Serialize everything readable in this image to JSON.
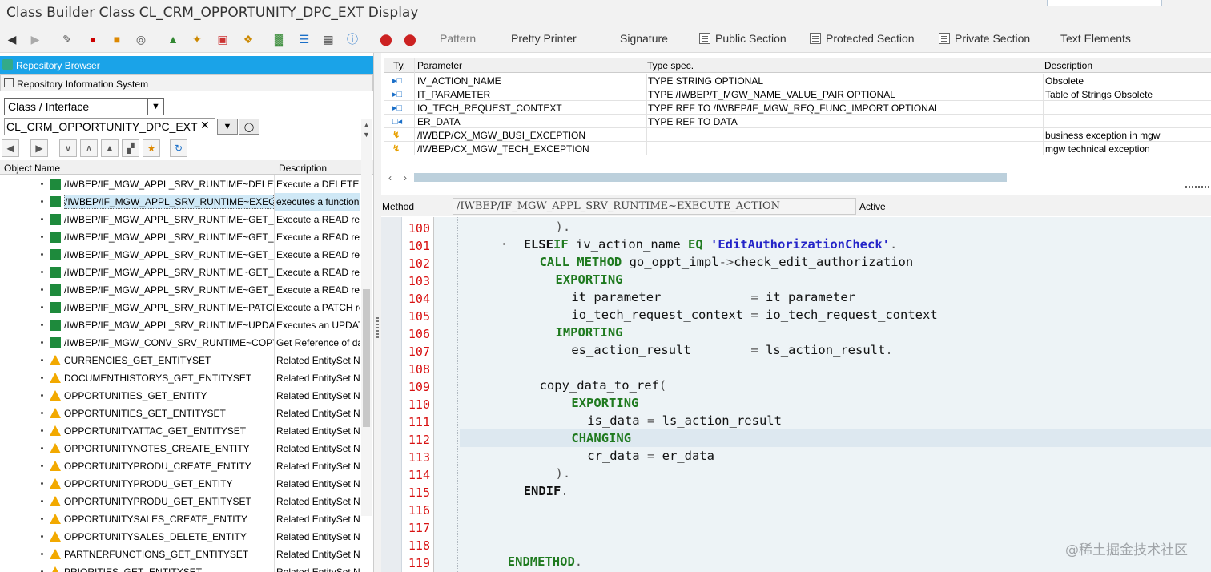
{
  "window": {
    "title": "Class Builder Class CL_CRM_OPPORTUNITY_DPC_EXT Display"
  },
  "toolbar": {
    "pattern": "Pattern",
    "pretty_printer": "Pretty Printer",
    "signature": "Signature",
    "public_section": "Public Section",
    "protected_section": "Protected Section",
    "private_section": "Private Section",
    "text_elements": "Text Elements"
  },
  "left": {
    "repository_browser": "Repository Browser",
    "repository_info": "Repository Information System",
    "object_type": "Class / Interface",
    "object_name": "CL_CRM_OPPORTUNITY_DPC_EXT",
    "col_object": "Object Name",
    "col_desc": "Description",
    "rows": [
      {
        "name": "/IWBEP/IF_MGW_APPL_SRV_RUNTIME~DELETE",
        "desc": "Execute a DELETE",
        "icon": "method"
      },
      {
        "name": "/IWBEP/IF_MGW_APPL_SRV_RUNTIME~EXECUTE",
        "desc": "executes a function",
        "icon": "method"
      },
      {
        "name": "/IWBEP/IF_MGW_APPL_SRV_RUNTIME~GET_EN",
        "desc": "Execute a READ req",
        "icon": "method"
      },
      {
        "name": "/IWBEP/IF_MGW_APPL_SRV_RUNTIME~GET_EN",
        "desc": "Execute a READ req",
        "icon": "method"
      },
      {
        "name": "/IWBEP/IF_MGW_APPL_SRV_RUNTIME~GET_EX",
        "desc": "Execute a READ req",
        "icon": "method"
      },
      {
        "name": "/IWBEP/IF_MGW_APPL_SRV_RUNTIME~GET_EX",
        "desc": "Execute a READ req",
        "icon": "method"
      },
      {
        "name": "/IWBEP/IF_MGW_APPL_SRV_RUNTIME~GET_ST",
        "desc": "Execute a READ req",
        "icon": "method"
      },
      {
        "name": "/IWBEP/IF_MGW_APPL_SRV_RUNTIME~PATCH_",
        "desc": "Execute a PATCH re",
        "icon": "method"
      },
      {
        "name": "/IWBEP/IF_MGW_APPL_SRV_RUNTIME~UPDATE",
        "desc": "Executes an UPDAT",
        "icon": "method"
      },
      {
        "name": "/IWBEP/IF_MGW_CONV_SRV_RUNTIME~COPY_",
        "desc": "Get Reference of da",
        "icon": "method"
      },
      {
        "name": "CURRENCIES_GET_ENTITYSET",
        "desc": "Related EntitySet Na",
        "icon": "warning"
      },
      {
        "name": "DOCUMENTHISTORYS_GET_ENTITYSET",
        "desc": "Related EntitySet Na",
        "icon": "warning"
      },
      {
        "name": "OPPORTUNITIES_GET_ENTITY",
        "desc": "Related EntitySet Na",
        "icon": "warning"
      },
      {
        "name": "OPPORTUNITIES_GET_ENTITYSET",
        "desc": "Related EntitySet Na",
        "icon": "warning"
      },
      {
        "name": "OPPORTUNITYATTAC_GET_ENTITYSET",
        "desc": "Related EntitySet Na",
        "icon": "warning"
      },
      {
        "name": "OPPORTUNITYNOTES_CREATE_ENTITY",
        "desc": "Related EntitySet Na",
        "icon": "warning"
      },
      {
        "name": "OPPORTUNITYPRODU_CREATE_ENTITY",
        "desc": "Related EntitySet Na",
        "icon": "warning"
      },
      {
        "name": "OPPORTUNITYPRODU_GET_ENTITY",
        "desc": "Related EntitySet Na",
        "icon": "warning"
      },
      {
        "name": "OPPORTUNITYPRODU_GET_ENTITYSET",
        "desc": "Related EntitySet Na",
        "icon": "warning"
      },
      {
        "name": "OPPORTUNITYSALES_CREATE_ENTITY",
        "desc": "Related EntitySet Na",
        "icon": "warning"
      },
      {
        "name": "OPPORTUNITYSALES_DELETE_ENTITY",
        "desc": "Related EntitySet Na",
        "icon": "warning"
      },
      {
        "name": "PARTNERFUNCTIONS_GET_ENTITYSET",
        "desc": "Related EntitySet Na",
        "icon": "warning"
      },
      {
        "name": "PRIORITIES_GET_ENTITYSET",
        "desc": "Related EntitySet Na",
        "icon": "warning"
      }
    ]
  },
  "params": {
    "col_ty": "Ty.",
    "col_param": "Parameter",
    "col_type": "Type spec.",
    "col_desc": "Description",
    "rows": [
      {
        "ty": "import",
        "param": "IV_ACTION_NAME",
        "type": "TYPE STRING OPTIONAL",
        "desc": "Obsolete"
      },
      {
        "ty": "import",
        "param": "IT_PARAMETER",
        "type": "TYPE /IWBEP/T_MGW_NAME_VALUE_PAIR OPTIONAL",
        "desc": "Table of Strings Obsolete"
      },
      {
        "ty": "import",
        "param": "IO_TECH_REQUEST_CONTEXT",
        "type": "TYPE REF TO /IWBEP/IF_MGW_REQ_FUNC_IMPORT OPTIONAL",
        "desc": ""
      },
      {
        "ty": "export",
        "param": "ER_DATA",
        "type": "TYPE REF TO DATA",
        "desc": ""
      },
      {
        "ty": "exception",
        "param": "/IWBEP/CX_MGW_BUSI_EXCEPTION",
        "type": "",
        "desc": "business exception in mgw"
      },
      {
        "ty": "exception",
        "param": "/IWBEP/CX_MGW_TECH_EXCEPTION",
        "type": "",
        "desc": "mgw technical exception"
      }
    ]
  },
  "method": {
    "label": "Method",
    "name": "/IWBEP/IF_MGW_APPL_SRV_RUNTIME~EXECUTE_ACTION",
    "status": "Active"
  },
  "editor": {
    "lines": [
      {
        "n": "100",
        "indent": 10,
        "html": "<span class='op'>).</span>"
      },
      {
        "n": "101",
        "indent": 6,
        "html": "<span class='kw-b'>ELSE</span><span class='kw'>IF</span> iv_action_name <span class='kw'>EQ</span> <span class='str'>'EditAuthorizationCheck'</span><span class='op'>.</span>"
      },
      {
        "n": "102",
        "indent": 8,
        "html": "<span class='kw'>CALL METHOD</span> go_oppt_impl<span class='op'>-&gt;</span>check_edit_authorization"
      },
      {
        "n": "103",
        "indent": 10,
        "html": "<span class='kw'>EXPORTING</span>"
      },
      {
        "n": "104",
        "indent": 12,
        "html": "it_parameter            <span class='op'>=</span> it_parameter"
      },
      {
        "n": "105",
        "indent": 12,
        "html": "io_tech_request_context <span class='op'>=</span> io_tech_request_context"
      },
      {
        "n": "106",
        "indent": 10,
        "html": "<span class='kw'>IMPORTING</span>"
      },
      {
        "n": "107",
        "indent": 12,
        "html": "es_action_result        <span class='op'>=</span> ls_action_result<span class='op'>.</span>"
      },
      {
        "n": "108",
        "indent": 0,
        "html": ""
      },
      {
        "n": "109",
        "indent": 8,
        "html": "copy_data_to_ref<span class='op'>(</span>"
      },
      {
        "n": "110",
        "indent": 12,
        "html": "<span class='kw'>EXPORTING</span>"
      },
      {
        "n": "111",
        "indent": 14,
        "html": "is_data <span class='op'>=</span> ls_action_result"
      },
      {
        "n": "112",
        "indent": 12,
        "html": "<span class='kw'>CHANGING</span>"
      },
      {
        "n": "113",
        "indent": 14,
        "html": "cr_data <span class='op'>=</span> er_data"
      },
      {
        "n": "114",
        "indent": 10,
        "html": "<span class='op'>).</span>"
      },
      {
        "n": "115",
        "indent": 6,
        "html": "<span class='kw-b'>ENDIF</span><span class='op'>.</span>"
      },
      {
        "n": "116",
        "indent": 0,
        "html": ""
      },
      {
        "n": "117",
        "indent": 0,
        "html": ""
      },
      {
        "n": "118",
        "indent": 0,
        "html": ""
      },
      {
        "n": "119",
        "indent": 4,
        "html": "<span class='kw'>ENDMETHOD</span><span class='op'>.</span>"
      }
    ]
  },
  "watermark": "@稀土掘金技术社区",
  "colors": {
    "selection_blue": "#1aa3e8",
    "keyword_green": "#1f7a1f",
    "string_blue": "#2323c8",
    "line_number_red": "#d81010"
  }
}
